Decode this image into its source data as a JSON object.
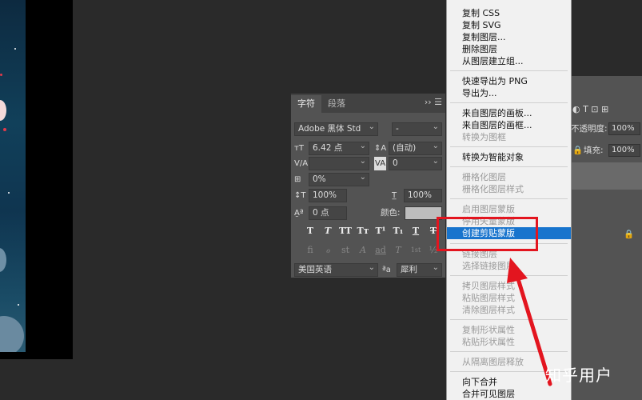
{
  "character_panel": {
    "tabs": [
      "字符",
      "段落"
    ],
    "menu_icons": "›› ☰",
    "font_family": "Adobe 黑体 Std",
    "font_style": "-",
    "font_size": "6.42 点",
    "leading": "(自动)",
    "kerning": "",
    "tracking": "0",
    "scale_percent": "0%",
    "vertical_scale": "100%",
    "horizontal_scale": "100%",
    "baseline_shift": "0 点",
    "color_label": "颜色:",
    "type_buttons": [
      "T",
      "T",
      "TT",
      "Tт",
      "T¹",
      "T₁",
      "T",
      "T"
    ],
    "opentype_buttons": [
      "fi",
      "ℴ",
      "st",
      "A",
      "ad",
      "T",
      "1st",
      "½"
    ],
    "language": "美国英语",
    "aa_label": "ªa",
    "antialias": "犀利"
  },
  "layers_panel": {
    "opacity_label": "不透明度:",
    "opacity_value": "100%",
    "fill_label": "填充:",
    "fill_value": "100%",
    "accent": "#535353"
  },
  "context_menu": {
    "items": [
      {
        "label": "复制 CSS",
        "enabled": true
      },
      {
        "label": "复制 SVG",
        "enabled": true
      },
      {
        "label": "复制图层...",
        "enabled": true
      },
      {
        "label": "删除图层",
        "enabled": true
      },
      {
        "label": "从图层建立组...",
        "enabled": true
      },
      {
        "label": "快速导出为 PNG",
        "enabled": true
      },
      {
        "label": "导出为...",
        "enabled": true
      },
      {
        "label": "来自图层的画板...",
        "enabled": true
      },
      {
        "label": "来自图层的画框...",
        "enabled": true
      },
      {
        "label": "转换为图框",
        "enabled": false
      },
      {
        "label": "转换为智能对象",
        "enabled": true
      },
      {
        "label": "栅格化图层",
        "enabled": false
      },
      {
        "label": "栅格化图层样式",
        "enabled": false
      },
      {
        "label": "启用图层蒙版",
        "enabled": false
      },
      {
        "label": "停用矢量蒙版",
        "enabled": false
      },
      {
        "label": "创建剪贴蒙版",
        "enabled": true,
        "selected": true
      },
      {
        "label": "链接图层",
        "enabled": false
      },
      {
        "label": "选择链接图层",
        "enabled": false
      },
      {
        "label": "拷贝图层样式",
        "enabled": false
      },
      {
        "label": "粘贴图层样式",
        "enabled": false
      },
      {
        "label": "清除图层样式",
        "enabled": false
      },
      {
        "label": "复制形状属性",
        "enabled": false
      },
      {
        "label": "粘贴形状属性",
        "enabled": false
      },
      {
        "label": "从隔离图层释放",
        "enabled": false
      },
      {
        "label": "向下合并",
        "enabled": true
      },
      {
        "label": "合并可见图层",
        "enabled": true
      }
    ],
    "highlight_color": "#1874cd"
  },
  "annotation": {
    "box_color": "#e3151f",
    "watermark": "知乎用户"
  }
}
